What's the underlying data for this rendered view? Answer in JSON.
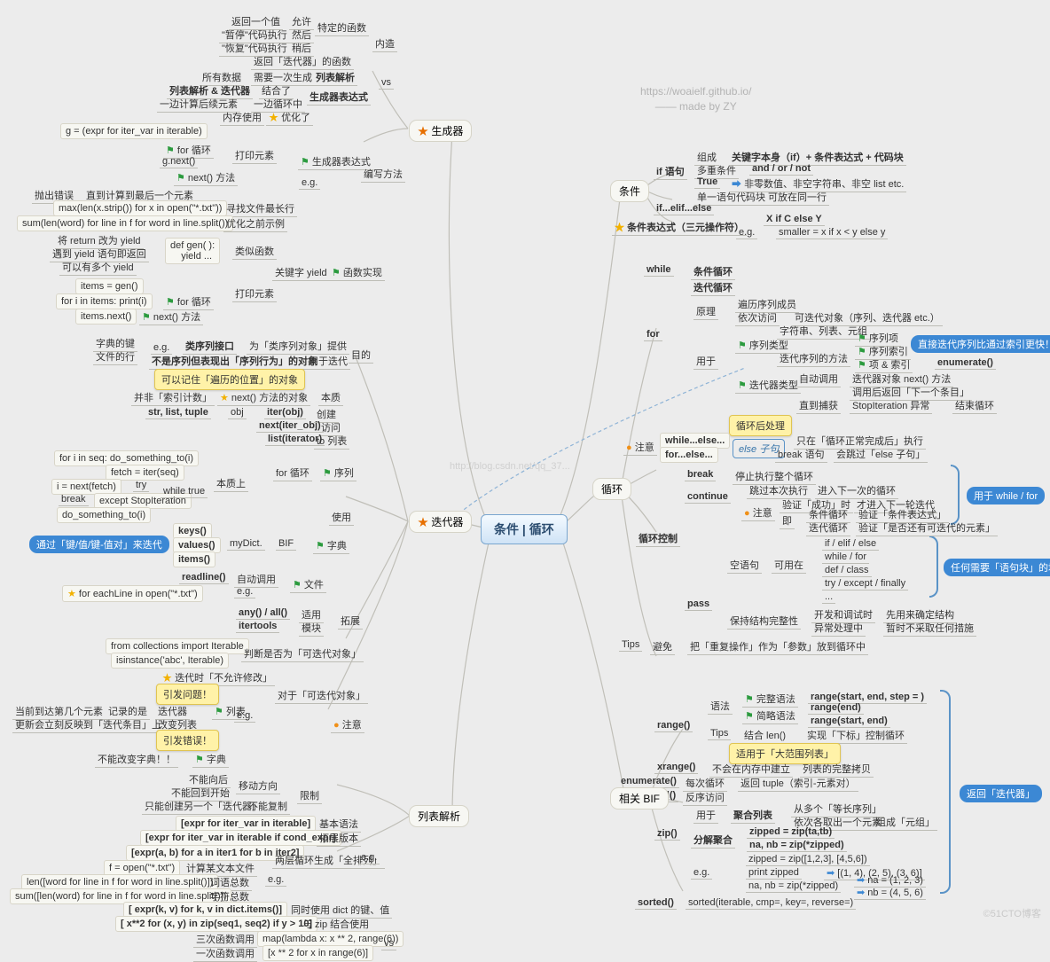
{
  "meta": {
    "l1": "https://woaielf.github.io/",
    "l2": "—— made by ZY"
  },
  "center": "条件 | 循环",
  "hubs": {
    "生成器": "生成器",
    "迭代器": "迭代器",
    "列表解析": "列表解析",
    "条件": "条件",
    "循环": "循环",
    "相关BIF": "相关 BIF"
  },
  "gen": {
    "ret": "返回一个值",
    "allow": "允许",
    "pause": "\"暂停\"代码执行",
    "then": "然后",
    "special": "特定的函数",
    "resume": "\"恢复\"代码执行",
    "later": "稍后",
    "retiter": "返回「迭代器」的函数",
    "neizao": "内造",
    "alldata": "所有数据",
    "needonce": "需要一次生成",
    "lba": "列表解析",
    "listiter": "列表解析 & 迭代器",
    "combine": "结合了",
    "calc": "一边计算后续元素",
    "inloop": "一边循环中",
    "genexp": "生成器表达式",
    "mem": "内存使用",
    "opt": "优化了",
    "gexpr": "g = (expr for iter_var in iterable)",
    "forloop": "for 循环",
    "printel": "打印元素",
    "gnext": "g.next()",
    "nextm": "next() 方法",
    "gen_expr_label": "生成器表达式",
    "eg": "e.g.",
    "writemethod": "编写方法",
    "err": "抛出错误",
    "until": "直到计算到最后一个元素",
    "maxlen": "max(len(x.strip()) for x in open(\"*.txt\"))",
    "longest": "寻找文件最长行",
    "sumlen": "sum(len(word) for line in f for word in line.split())",
    "preopt": "优化之前示例",
    "retyield": "将 return 改为 yield",
    "yieldret": "遇到 yield 语句即返回",
    "multiyield": "可以有多个 yield",
    "defgen": "def gen( ):\n    yield ...",
    "likefun": "类似函数",
    "kwyield": "关键字 yield",
    "funimpl": "函数实现",
    "items": "items = gen()",
    "foritems": "for i in items: print(i)",
    "itemsnext": "items.next()"
  },
  "iter": {
    "dictkey": "字典的键",
    "fileline": "文件的行",
    "cls_seq": "类序列接口",
    "for_cls": "为「类序列对象」提供",
    "purpose": "目的",
    "notseq": "不是序列但表现出「序列行为」的对象",
    "foriter": "用于迭代",
    "remember": "可以记住「遍历的位置」的对象",
    "notindex": "并非「索引计数」",
    "ess_next": "next() 方法的对象",
    "essence": "本质",
    "slt": "str, list, tuple",
    "obj": "obj",
    "iterobj": "iter(obj)",
    "create": "创建",
    "nextiter": "next(iter_obj)",
    "visit": "访问",
    "listiter": "list(iterator)",
    "tolist": "to 列表",
    "foriinseq": "for i in seq: do_something_to(i)",
    "fetch": "fetch = iter(seq)",
    "inext": "i = next(fetch)",
    "tryk": "try",
    "brk": "break",
    "except": "except StopIteration",
    "whiletrue": "while true",
    "dosth": "do_something_to(i)",
    "forloop": "for 循环",
    "seq": "序列",
    "essentially": "本质上",
    "keys": "keys()",
    "values": "values()",
    "itemsf": "items()",
    "mydict": "myDict.",
    "bif": "BIF",
    "dict": "字典",
    "readline": "readline()",
    "auto": "自动调用",
    "file": "文件",
    "foreachline": "for eachLine in open(\"*.txt\")",
    "anyall": "any() / all()",
    "apply": "适用",
    "itertools": "itertools",
    "module": "模块",
    "extend": "拓展",
    "use": "使用",
    "fromcoll": "from collections import Iterable",
    "isinstance": "isinstance('abc', Iterable)",
    "judge": "判断是否为「可迭代对象」",
    "noedit": "迭代时「不允许修改」",
    "triggerQ": "引发问题！",
    "triggerE": "引发错误！",
    "curidx": "当前到达第几个元素",
    "record": "记录的是",
    "iterator": "迭代器",
    "list": "列表",
    "chgseq": "改变列表",
    "update": "更新会立刻反映到「迭代条目」上",
    "nochgdict": "不能改变字典！！",
    "dictw": "字典",
    "notback": "不能向后",
    "notstart": "不能回到开始",
    "movedir": "移动方向",
    "onlynew": "只能创建另一个「迭代器」",
    "nocopy": "不能复制",
    "limit": "限制",
    "foriterable": "对于「可迭代对象」",
    "caution": "注意"
  },
  "lp": {
    "basic": "[expr for iter_var in iterable]",
    "basicsyn": "基本语法",
    "cond": "[expr for iter_var in iterable if cond_expr]",
    "extver": "拓展版本",
    "twolayer": "两层循环生成「全排列」",
    "dbl": "[expr(a, b) for a in iter1 for b in iter2]",
    "fopen": "f = open(\"*.txt\")",
    "readtxt": "计算某文本文件",
    "lencnt": "len([word for line in f for word in line.split()])",
    "wordcnt": "词语总数",
    "sumsum": "sum([len(word) for line in f for word in line.split()])",
    "charcnt": "字符总数",
    "dictex": "[ expr(k, v) for k, v in dict.items()]",
    "usedict": "同时使用 dict 的键、值",
    "zipex": "[ x**2 for (x, y) in zip(seq1, seq2) if y > 10]",
    "withzip": "与 zip 结合使用",
    "map": "map(lambda x: x ** 2, range(6))",
    "three": "三次函数调用",
    "one": "一次函数调用",
    "listcomp": "[x ** 2 for x in range(6)]",
    "vs": "vs",
    "eg": "e.g."
  },
  "cond": {
    "if": "if 语句",
    "comp": "组成",
    "kw": "关键字本身（if）+ 条件表达式 + 代码块",
    "multi": "多重条件",
    "andor": "and / or / not",
    "true": "True",
    "nonzero": "非零数值、非空字符串、非空 list etc.",
    "single": "单一语句代码块",
    "sameline": "可放在同一行",
    "elif": "if...elif...else",
    "ternary": "条件表达式（三元操作符）",
    "xifc": "X if C else Y",
    "smaller": "smaller = x if x < y else y"
  },
  "loop": {
    "while": "while",
    "condloop": "条件循环",
    "iterloop": "迭代循环",
    "for": "for",
    "principle": "原理",
    "itermember": "遍历序列成员",
    "seqvisit": "依次访问",
    "iterable": "可迭代对象（序列、迭代器 etc.）",
    "str": "字符串、列表、元组",
    "seqtype": "序列类型",
    "seqitem": "序列项",
    "seqidx": "序列索引",
    "itemidx": "项 & 索引",
    "itermethod": "迭代序列的方法",
    "enumerate": "enumerate()",
    "usedfor": "用于",
    "160": "直接迭代序列比通过索引更快！",
    "itertype": "迭代器类型",
    "autocall": "自动调用",
    "nextm": "迭代器对象 next() 方法",
    "retnext": "调用后返回「下一个条目」",
    "untilcatch": "直到捕获",
    "stopiter": "StopIteration 异常",
    "endloop": "结束循环",
    "post": "循环后处理",
    "welse": "while...else...",
    "felse": "for...else...",
    "elseclause": "else 子句",
    "onlydone": "只在「循环正常完成后」执行",
    "breakword": "break 语句",
    "skip": "会跳过「else 子句」",
    "break": "break",
    "stopall": "停止执行整个循环",
    "continue": "continue",
    "skipthis": "跳过本次执行",
    "nextiter": "进入下一次的循环",
    "next": "才进入下一轮迭代",
    "verify": "验证「成功」时",
    "ji": "即",
    "condl": "条件循环",
    "verifycond": "验证「条件表达式」",
    "iterl": "迭代循环",
    "verifyiter": "验证「是否还有可迭代的元素」",
    "loopctrl": "循环控制",
    "pass": "pass",
    "empty": "空语句",
    "canuse": "可用在",
    "ifelif": "if / elif / else",
    "whilefor": "while / for",
    "defclass": "def / class",
    "tryexcept": "try / except / finally",
    "dots": "...",
    "keepstruct": "保持结构完整性",
    "devdebug": "开发和调试时",
    "predefine": "先用来确定结构",
    "exc": "异常处理中",
    "noop": "暂时不采取任何措施",
    "tips": "Tips",
    "avoid": "避免",
    "heavy": "把「重复操作」作为「参数」放到循环中",
    "whilebrace": "用于 while / for",
    "passbrace": "任何需要「语句块」的地方",
    "caution": "注意"
  },
  "bif": {
    "range": "range()",
    "syntax": "语法",
    "full": "完整语法",
    "rfull": "range(start, end, step = )",
    "simple": "简略语法",
    "rend": "range(end)",
    "rstart": "range(start, end)",
    "tips": "Tips",
    "withlen": "结合 len()",
    "idxctrl": "实现「下标」控制循环",
    "bigrange": "适用于「大范围列表」",
    "xrange": "xrange()",
    "nomem": "不会在内存中建立",
    "fullcopy": "列表的完整拷贝",
    "enum": "enumerate()",
    "eachiter": "每次循环",
    "rettuple": "返回 tuple（索引-元素对）",
    "rev": "reversed()",
    "revvisit": "反序访问",
    "zip": "zip()",
    "usefor": "用于",
    "aggr": "聚合列表",
    "fromseq": "从多个「等长序列」",
    "taketuple": "依次各取出一个元素",
    "maketuple": "组成「元组」",
    "decompose": "分解聚合",
    "zipped": "zipped = zip(ta,tb)",
    "unzip": "na, nb = zip(*zipped)",
    "zipex": "zipped = zip([1,2,3], [4,5,6])",
    "printzip": "print zipped",
    "ziparr": "[(1, 4), (2, 5), (3, 6)]",
    "unzip2": "na, nb = zip(*zipped)",
    "na": "na = (1, 2, 3)",
    "nb": "nb = (4, 5, 6)",
    "sorted": "sorted()",
    "sortedex": "sorted(iterable, cmp=, key=, reverse=)",
    "dictiter": "通过「键/值/键-值对」来迭代",
    "brlabel": "返回「迭代器」",
    "eg": "e.g."
  },
  "wm": "©51CTO博客",
  "wm2": "http://blog.csdn.net/qq_37..."
}
